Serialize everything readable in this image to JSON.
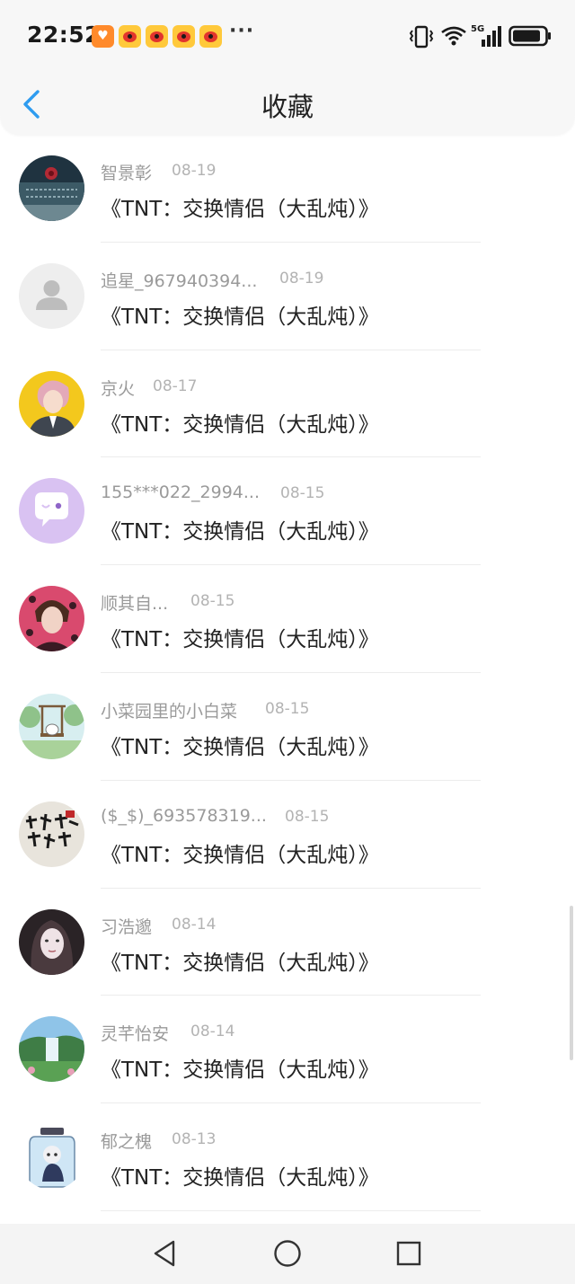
{
  "status": {
    "time": "22:52",
    "more": "···",
    "network": "5G",
    "icons": [
      "notification-orange-icon",
      "weibo-icon",
      "weibo-icon",
      "weibo-icon",
      "weibo-icon",
      "vibrate-icon",
      "wifi-icon",
      "signal-icon",
      "battery-icon"
    ]
  },
  "header": {
    "title": "收藏",
    "back_icon": "chevron-left-icon"
  },
  "colors": {
    "accent": "#2e9cf0",
    "name_gray": "#9a9a9a",
    "date_gray": "#b3b3b3",
    "text": "#222222",
    "divider": "#ececec"
  },
  "items": [
    {
      "name": "智景彰",
      "date": "08-19",
      "work": "《TNT：交换情侣（大乱炖）》",
      "avatar": "dark-rose-avatar"
    },
    {
      "name": "追星_967940394...",
      "date": "08-19",
      "work": "《TNT：交换情侣（大乱炖）》",
      "avatar": "default-person-avatar"
    },
    {
      "name": "京火",
      "date": "08-17",
      "work": "《TNT：交换情侣（大乱炖）》",
      "avatar": "anime-boy-avatar"
    },
    {
      "name": "155***022_2994...",
      "date": "08-15",
      "work": "《TNT：交换情侣（大乱炖）》",
      "avatar": "purple-chat-avatar"
    },
    {
      "name": "顺其自...",
      "date": "08-15",
      "work": "《TNT：交换情侣（大乱炖）》",
      "avatar": "pink-portrait-avatar"
    },
    {
      "name": "小菜园里的小白菜",
      "date": "08-15",
      "work": "《TNT：交换情侣（大乱炖）》",
      "avatar": "cartoon-swing-avatar"
    },
    {
      "name": "($_$)_693578319...",
      "date": "08-15",
      "work": "《TNT：交换情侣（大乱炖）》",
      "avatar": "calligraphy-avatar"
    },
    {
      "name": "习浩邈",
      "date": "08-14",
      "work": "《TNT：交换情侣（大乱炖）》",
      "avatar": "girl-portrait-avatar"
    },
    {
      "name": "灵芊怡安",
      "date": "08-14",
      "work": "《TNT：交换情侣（大乱炖）》",
      "avatar": "waterfall-avatar"
    },
    {
      "name": "郁之槐",
      "date": "08-13",
      "work": "《TNT：交换情侣（大乱炖）》",
      "avatar": "jar-figure-avatar"
    }
  ],
  "bottom_nav": {
    "icons": [
      "back-triangle-icon",
      "home-circle-icon",
      "recents-square-icon"
    ]
  }
}
